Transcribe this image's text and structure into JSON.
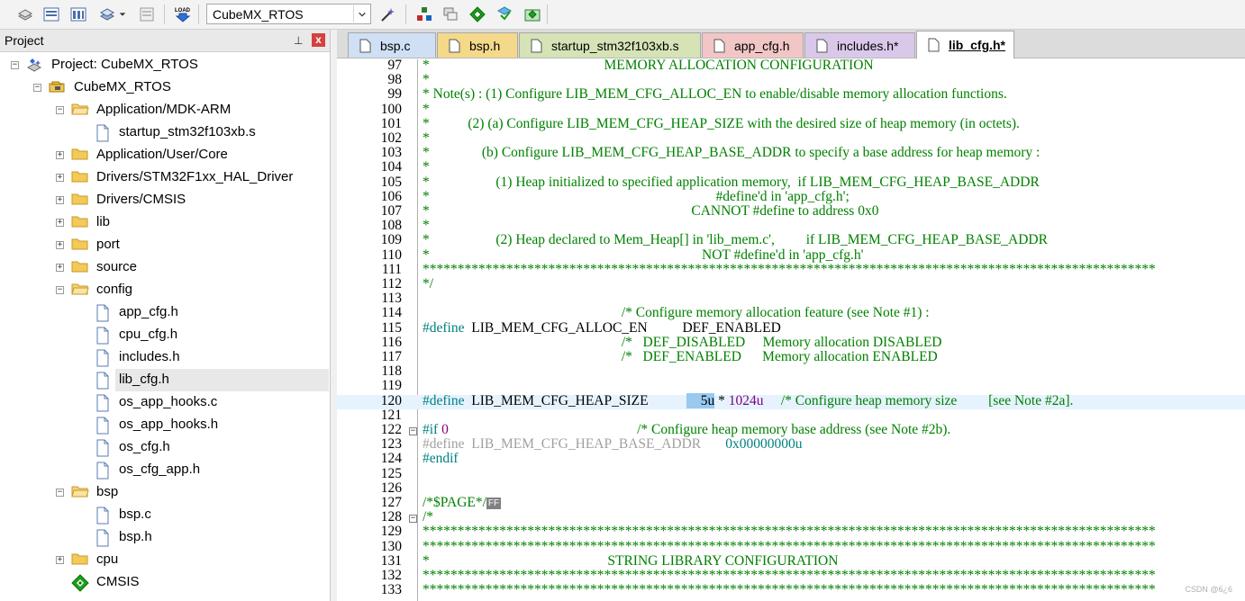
{
  "toolbar": {
    "target": "CubeMX_RTOS"
  },
  "project_panel": {
    "title": "Project",
    "pin_glyph": "⊥",
    "close_glyph": "x",
    "tree": [
      {
        "label": "Project: CubeMX_RTOS",
        "level": 0,
        "exp": "−",
        "icon": "project-root-icon"
      },
      {
        "label": "CubeMX_RTOS",
        "level": 1,
        "exp": "−",
        "icon": "target-icon"
      },
      {
        "label": "Application/MDK-ARM",
        "level": 2,
        "exp": "−",
        "icon": "folder-open-icon"
      },
      {
        "label": "startup_stm32f103xb.s",
        "level": 3,
        "exp": "",
        "icon": "file-icon"
      },
      {
        "label": "Application/User/Core",
        "level": 2,
        "exp": "+",
        "icon": "folder-icon"
      },
      {
        "label": "Drivers/STM32F1xx_HAL_Driver",
        "level": 2,
        "exp": "+",
        "icon": "folder-icon"
      },
      {
        "label": "Drivers/CMSIS",
        "level": 2,
        "exp": "+",
        "icon": "folder-icon"
      },
      {
        "label": "lib",
        "level": 2,
        "exp": "+",
        "icon": "folder-icon"
      },
      {
        "label": "port",
        "level": 2,
        "exp": "+",
        "icon": "folder-icon"
      },
      {
        "label": "source",
        "level": 2,
        "exp": "+",
        "icon": "folder-icon"
      },
      {
        "label": "config",
        "level": 2,
        "exp": "−",
        "icon": "folder-open-icon"
      },
      {
        "label": "app_cfg.h",
        "level": 3,
        "exp": "",
        "icon": "file-icon"
      },
      {
        "label": "cpu_cfg.h",
        "level": 3,
        "exp": "",
        "icon": "file-icon"
      },
      {
        "label": "includes.h",
        "level": 3,
        "exp": "",
        "icon": "file-icon"
      },
      {
        "label": "lib_cfg.h",
        "level": 3,
        "exp": "",
        "icon": "file-icon",
        "selected": true
      },
      {
        "label": "os_app_hooks.c",
        "level": 3,
        "exp": "",
        "icon": "file-icon"
      },
      {
        "label": "os_app_hooks.h",
        "level": 3,
        "exp": "",
        "icon": "file-icon"
      },
      {
        "label": "os_cfg.h",
        "level": 3,
        "exp": "",
        "icon": "file-icon"
      },
      {
        "label": "os_cfg_app.h",
        "level": 3,
        "exp": "",
        "icon": "file-icon"
      },
      {
        "label": "bsp",
        "level": 2,
        "exp": "−",
        "icon": "folder-open-icon"
      },
      {
        "label": "bsp.c",
        "level": 3,
        "exp": "",
        "icon": "file-icon"
      },
      {
        "label": "bsp.h",
        "level": 3,
        "exp": "",
        "icon": "file-icon"
      },
      {
        "label": "cpu",
        "level": 2,
        "exp": "+",
        "icon": "folder-icon"
      },
      {
        "label": "CMSIS",
        "level": 2,
        "exp": "",
        "icon": "cmsis-diamond-icon"
      }
    ]
  },
  "tabs": [
    {
      "label": "bsp.c",
      "color": "#cfe0f5"
    },
    {
      "label": "bsp.h",
      "color": "#f5d98a"
    },
    {
      "label": "startup_stm32f103xb.s",
      "color": "#d5e3b6"
    },
    {
      "label": "app_cfg.h",
      "color": "#f2c6c6"
    },
    {
      "label": "includes.h*",
      "color": "#dac8ea"
    },
    {
      "label": "lib_cfg.h*",
      "color": "#e8eef6",
      "active": true
    }
  ],
  "code": {
    "highlight_line": 120,
    "lines": [
      {
        "n": "97",
        "segs": [
          [
            "cmt",
            "*                                                  MEMORY ALLOCATION CONFIGURATION"
          ]
        ]
      },
      {
        "n": "98",
        "segs": [
          [
            "cmt",
            "*"
          ]
        ]
      },
      {
        "n": "99",
        "segs": [
          [
            "cmt",
            "* Note(s) : (1) Configure LIB_MEM_CFG_ALLOC_EN to enable/disable memory allocation functions."
          ]
        ]
      },
      {
        "n": "100",
        "segs": [
          [
            "cmt",
            "*"
          ]
        ]
      },
      {
        "n": "101",
        "segs": [
          [
            "cmt",
            "*           (2) (a) Configure LIB_MEM_CFG_HEAP_SIZE with the desired size of heap memory (in octets)."
          ]
        ]
      },
      {
        "n": "102",
        "segs": [
          [
            "cmt",
            "*"
          ]
        ]
      },
      {
        "n": "103",
        "segs": [
          [
            "cmt",
            "*               (b) Configure LIB_MEM_CFG_HEAP_BASE_ADDR to specify a base address for heap memory :"
          ]
        ]
      },
      {
        "n": "104",
        "segs": [
          [
            "cmt",
            "*"
          ]
        ]
      },
      {
        "n": "105",
        "segs": [
          [
            "cmt",
            "*                   (1) Heap initialized to specified application memory,  if LIB_MEM_CFG_HEAP_BASE_ADDR"
          ]
        ]
      },
      {
        "n": "106",
        "segs": [
          [
            "cmt",
            "*                                                                                  #define'd in 'app_cfg.h';"
          ]
        ]
      },
      {
        "n": "107",
        "segs": [
          [
            "cmt",
            "*                                                                           CANNOT #define to address 0x0"
          ]
        ]
      },
      {
        "n": "108",
        "segs": [
          [
            "cmt",
            "*"
          ]
        ]
      },
      {
        "n": "109",
        "segs": [
          [
            "cmt",
            "*                   (2) Heap declared to Mem_Heap[] in 'lib_mem.c',         if LIB_MEM_CFG_HEAP_BASE_ADDR"
          ]
        ]
      },
      {
        "n": "110",
        "segs": [
          [
            "cmt",
            "*                                                                              NOT #define'd in 'app_cfg.h'"
          ]
        ]
      },
      {
        "n": "111",
        "segs": [
          [
            "cmt",
            "*********************************************************************************************************"
          ]
        ]
      },
      {
        "n": "112",
        "segs": [
          [
            "cmt",
            "*/"
          ]
        ]
      },
      {
        "n": "113",
        "segs": []
      },
      {
        "n": "114",
        "segs": [
          [
            "cmt",
            "                                                         /* Configure memory allocation feature (see Note #1) :"
          ]
        ]
      },
      {
        "n": "115",
        "segs": [
          [
            "kw",
            "#define"
          ],
          [
            "",
            "  LIB_MEM_CFG_ALLOC_EN          DEF_ENABLED"
          ]
        ]
      },
      {
        "n": "116",
        "segs": [
          [
            "cmt",
            "                                                         /*   DEF_DISABLED     Memory allocation DISABLED"
          ]
        ]
      },
      {
        "n": "117",
        "segs": [
          [
            "cmt",
            "                                                         /*   DEF_ENABLED      Memory allocation ENABLED"
          ]
        ]
      },
      {
        "n": "118",
        "segs": []
      },
      {
        "n": "119",
        "segs": []
      },
      {
        "n": "120",
        "segs": [
          [
            "kw",
            "#define"
          ],
          [
            "",
            "  LIB_MEM_CFG_HEAP_SIZE           "
          ],
          [
            "sel",
            "    5u"
          ],
          [
            "",
            " * "
          ],
          [
            "num",
            "1024u"
          ],
          [
            "",
            "     "
          ],
          [
            "cmt",
            "/* Configure heap memory size         [see Note #2a]."
          ]
        ]
      },
      {
        "n": "121",
        "segs": []
      },
      {
        "n": "122",
        "fold": "−",
        "segs": [
          [
            "kw",
            "#if"
          ],
          [
            "",
            " "
          ],
          [
            "num",
            "0"
          ],
          [
            "",
            "                                                      "
          ],
          [
            "cmt",
            "/* Configure heap memory base address (see Note #2b)."
          ]
        ]
      },
      {
        "n": "123",
        "segs": [
          [
            "gray",
            "#define  LIB_MEM_CFG_HEAP_BASE_ADDR       "
          ],
          [
            "kw",
            "0x00000000u"
          ]
        ]
      },
      {
        "n": "124",
        "segs": [
          [
            "kw",
            "#endif"
          ]
        ]
      },
      {
        "n": "125",
        "segs": []
      },
      {
        "n": "126",
        "segs": []
      },
      {
        "n": "127",
        "segs": [
          [
            "cmt",
            "/*$PAGE*/"
          ],
          [
            "ff",
            "FF"
          ]
        ]
      },
      {
        "n": "128",
        "fold": "−",
        "segs": [
          [
            "cmt",
            "/*"
          ]
        ]
      },
      {
        "n": "129",
        "segs": [
          [
            "cmt",
            "*********************************************************************************************************"
          ]
        ]
      },
      {
        "n": "130",
        "segs": [
          [
            "cmt",
            "*********************************************************************************************************"
          ]
        ]
      },
      {
        "n": "131",
        "segs": [
          [
            "cmt",
            "*                                                   STRING LIBRARY CONFIGURATION"
          ]
        ]
      },
      {
        "n": "132",
        "segs": [
          [
            "cmt",
            "*********************************************************************************************************"
          ]
        ]
      },
      {
        "n": "133",
        "segs": [
          [
            "cmt",
            "*********************************************************************************************************"
          ]
        ]
      }
    ]
  },
  "watermark": "CSDN @6¿6"
}
